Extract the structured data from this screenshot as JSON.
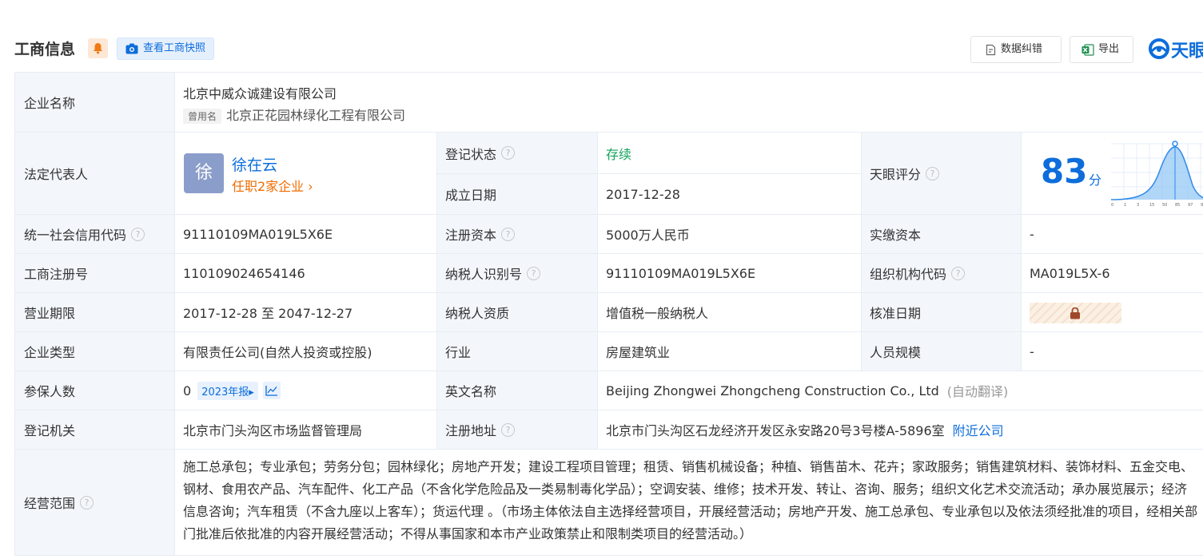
{
  "header": {
    "title": "工商信息",
    "snapshot_label": "查看工商快照",
    "report_label": "数据纠错",
    "export_label": "导出",
    "logo_text": "天眼"
  },
  "colors": {
    "accent": "#0d6ddb",
    "label_bg": "#f3f7fc",
    "status_green": "#14a35b",
    "orange": "#f06c00"
  },
  "company": {
    "name_label": "企业名称",
    "name": "北京中威众诚建设有限公司",
    "former_tag": "曾用名",
    "former_name": "北京正花园林绿化工程有限公司"
  },
  "legal": {
    "label": "法定代表人",
    "avatar_char": "徐",
    "person": "徐在云",
    "positions": "任职2家企业",
    "chev": "›"
  },
  "status": {
    "label": "登记状态",
    "value": "存续"
  },
  "founded": {
    "label": "成立日期",
    "value": "2017-12-28"
  },
  "rating": {
    "label": "天眼评分",
    "score": "83",
    "unit": "分",
    "score_value": 83,
    "axis_ticks": [
      "0",
      "1",
      "3",
      "15",
      "50",
      "85",
      "97",
      "9"
    ]
  },
  "rows": {
    "credit_code": {
      "label": "统一社会信用代码",
      "value": "91110109MA019L5X6E"
    },
    "reg_capital": {
      "label": "注册资本",
      "value": "5000万人民币"
    },
    "paid_capital": {
      "label": "实缴资本",
      "value": "-"
    },
    "reg_no": {
      "label": "工商注册号",
      "value": "110109024654146"
    },
    "taxpayer_id": {
      "label": "纳税人识别号",
      "value": "91110109MA019L5X6E"
    },
    "org_code": {
      "label": "组织机构代码",
      "value": "MA019L5X-6"
    },
    "term": {
      "label": "营业期限",
      "value": "2017-12-28 至 2047-12-27"
    },
    "taxpayer_qual": {
      "label": "纳税人资质",
      "value": "增值税一般纳税人"
    },
    "approval_date": {
      "label": "核准日期"
    },
    "type": {
      "label": "企业类型",
      "value": "有限责任公司(自然人投资或控股)"
    },
    "industry": {
      "label": "行业",
      "value": "房屋建筑业"
    },
    "staff_size": {
      "label": "人员规模",
      "value": "-"
    },
    "insured": {
      "label": "参保人数",
      "value": "0",
      "year_tag": "2023年报",
      "year_arrow": "▸"
    },
    "english_name": {
      "label": "英文名称",
      "value": "Beijing Zhongwei Zhongcheng Construction Co., Ltd",
      "hint": "(自动翻译)"
    },
    "authority": {
      "label": "登记机关",
      "value": "北京市门头沟区市场监督管理局"
    },
    "address": {
      "label": "注册地址",
      "value": "北京市门头沟区石龙经济开发区永安路20号3号楼A-5896室",
      "nearby": "附近公司"
    },
    "scope": {
      "label": "经营范围",
      "value": "施工总承包；专业承包；劳务分包；园林绿化；房地产开发；建设工程项目管理；租赁、销售机械设备；种植、销售苗木、花卉；家政服务；销售建筑材料、装饰材料、五金交电、钢材、食用农产品、汽车配件、化工产品（不含化学危险品及一类易制毒化学品）；空调安装、维修；技术开发、转让、咨询、服务；组织文化艺术交流活动；承办展览展示；经济信息咨询；汽车租赁（不含九座以上客车）；货运代理 。（市场主体依法自主选择经营项目，开展经营活动；房地产开发、施工总承包、专业承包以及依法须经批准的项目，经相关部门批准后依批准的内容开展经营活动；不得从事国家和本市产业政策禁止和限制类项目的经营活动。）"
    }
  },
  "icons": {
    "question": "?",
    "bell": "bell-icon",
    "camera": "camera-icon",
    "report": "report-icon",
    "excel": "excel-icon",
    "lock": "lock-icon",
    "trend": "trend-chart-icon"
  }
}
